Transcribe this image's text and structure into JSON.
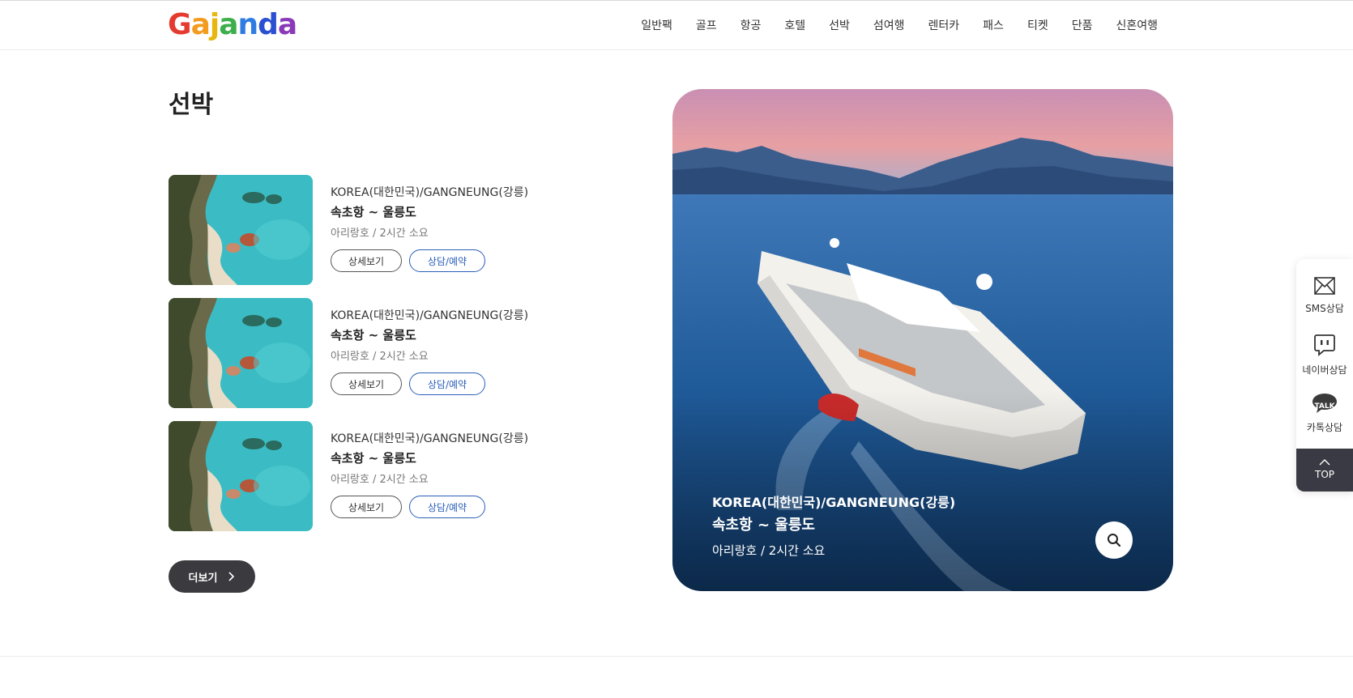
{
  "brand": {
    "logo_letters": [
      "G",
      "a",
      "j",
      "a",
      "n",
      "d",
      "a"
    ],
    "logo_colors": [
      "#e53a2f",
      "#f29b1f",
      "#f2c81f",
      "#3cae4a",
      "#2f7de1",
      "#2b4fd1",
      "#8a3ab9"
    ]
  },
  "nav": {
    "items": [
      "일반팩",
      "골프",
      "항공",
      "호텔",
      "선박",
      "섬여행",
      "렌터카",
      "패스",
      "티켓",
      "단품",
      "신혼여행"
    ]
  },
  "page": {
    "title": "선박"
  },
  "products": [
    {
      "location": "KOREA(대한민국)/GANGNEUNG(강릉)",
      "route": "속초항 ~ 울릉도",
      "meta": "아리랑호 / 2시간 소요",
      "detail_label": "상세보기",
      "book_label": "상담/예약"
    },
    {
      "location": "KOREA(대한민국)/GANGNEUNG(강릉)",
      "route": "속초항 ~ 울릉도",
      "meta": "아리랑호 / 2시간 소요",
      "detail_label": "상세보기",
      "book_label": "상담/예약"
    },
    {
      "location": "KOREA(대한민국)/GANGNEUNG(강릉)",
      "route": "속초항 ~ 울릉도",
      "meta": "아리랑호 / 2시간 소요",
      "detail_label": "상세보기",
      "book_label": "상담/예약"
    }
  ],
  "more": {
    "label": "더보기"
  },
  "hero": {
    "location": "KOREA(대한민국)/GANGNEUNG(강릉)",
    "route": "속초항 ~ 울릉도",
    "meta": "아리랑호 / 2시간 소요"
  },
  "side": {
    "sms": "SMS상담",
    "naver": "네이버상담",
    "kakao": "카톡상담",
    "kakao_badge": "TALK",
    "top": "TOP"
  },
  "colors": {
    "accent_blue": "#2a5fb8",
    "dark": "#3b3b3f"
  }
}
